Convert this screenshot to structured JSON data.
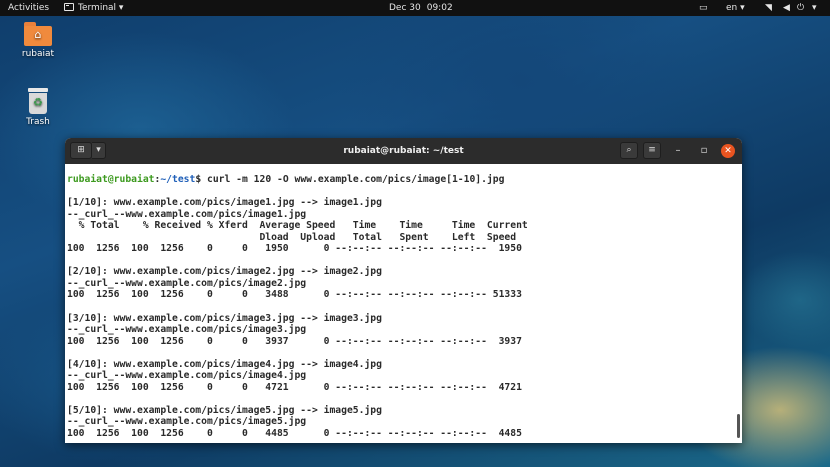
{
  "topbar": {
    "activities": "Activities",
    "app_name": "Terminal",
    "app_menu_icon": "chevron-down-icon",
    "date": "Dec 30",
    "time": "09:02",
    "language": "en"
  },
  "desktop": {
    "home_label": "rubaiat",
    "trash_label": "Trash"
  },
  "window": {
    "title": "rubaiat@rubaiat: ~/test"
  },
  "terminal": {
    "prompt_user": "rubaiat@rubaiat",
    "prompt_sep": ":",
    "prompt_path": "~/test",
    "prompt_symbol": "$",
    "command": " curl -m 120 -O www.example.com/pics/image[1-10].jpg",
    "output": "\n[1/10]: www.example.com/pics/image1.jpg --> image1.jpg\n--_curl_--www.example.com/pics/image1.jpg\n  % Total    % Received % Xferd  Average Speed   Time    Time     Time  Current\n                                 Dload  Upload   Total   Spent    Left  Speed\n100  1256  100  1256    0     0   1950      0 --:--:-- --:--:-- --:--:--  1950\n\n[2/10]: www.example.com/pics/image2.jpg --> image2.jpg\n--_curl_--www.example.com/pics/image2.jpg\n100  1256  100  1256    0     0   3488      0 --:--:-- --:--:-- --:--:-- 51333\n\n[3/10]: www.example.com/pics/image3.jpg --> image3.jpg\n--_curl_--www.example.com/pics/image3.jpg\n100  1256  100  1256    0     0   3937      0 --:--:-- --:--:-- --:--:--  3937\n\n[4/10]: www.example.com/pics/image4.jpg --> image4.jpg\n--_curl_--www.example.com/pics/image4.jpg\n100  1256  100  1256    0     0   4721      0 --:--:-- --:--:-- --:--:--  4721\n\n[5/10]: www.example.com/pics/image5.jpg --> image5.jpg\n--_curl_--www.example.com/pics/image5.jpg\n100  1256  100  1256    0     0   4485      0 --:--:-- --:--:-- --:--:--  4485"
  }
}
